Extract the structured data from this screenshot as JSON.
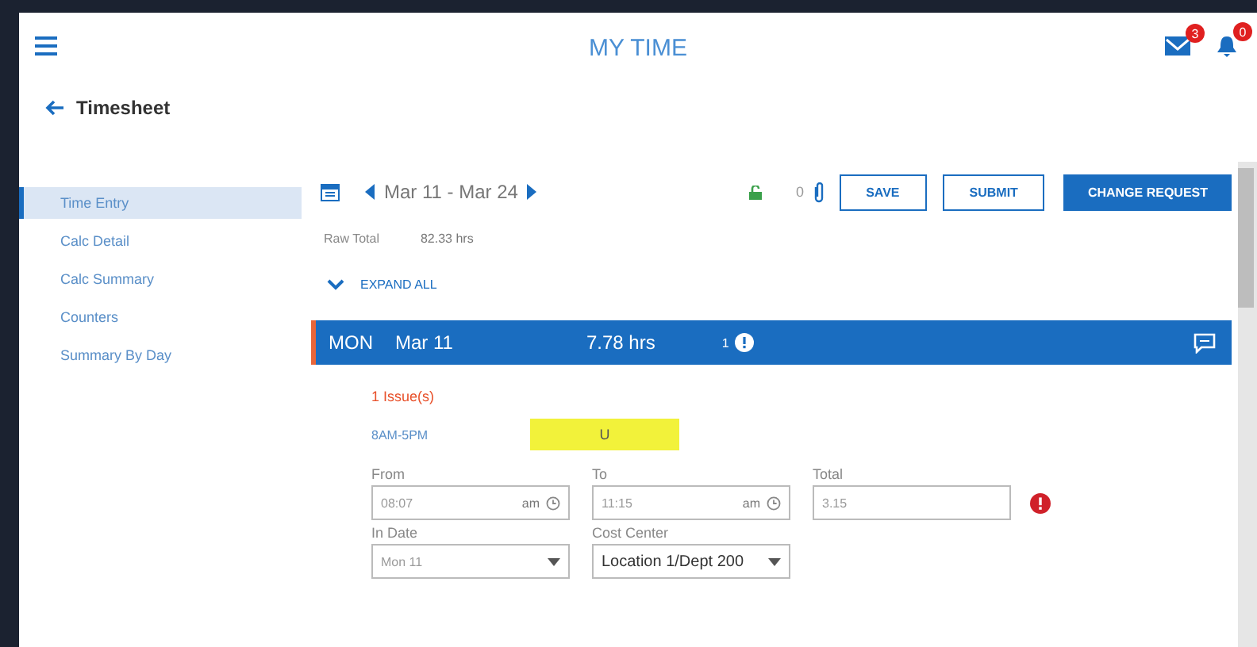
{
  "header": {
    "title": "MY TIME",
    "mail_badge": "3",
    "bell_badge": "0"
  },
  "page": {
    "back_title": "Timesheet"
  },
  "sidebar": {
    "items": [
      {
        "label": "Time Entry",
        "selected": true
      },
      {
        "label": "Calc Detail",
        "selected": false
      },
      {
        "label": "Calc Summary",
        "selected": false
      },
      {
        "label": "Counters",
        "selected": false
      },
      {
        "label": "Summary By Day",
        "selected": false
      }
    ]
  },
  "toolbar": {
    "period": "Mar 11 - Mar 24",
    "attachments": "0",
    "buttons": [
      {
        "label": "SAVE",
        "kind": "outline"
      },
      {
        "label": "SUBMIT",
        "kind": "outline"
      },
      {
        "label": "CHANGE REQUEST",
        "kind": "primary"
      }
    ]
  },
  "raw_total": {
    "label": "Raw Total",
    "value": "82.33 hrs"
  },
  "expand_all": "EXPAND ALL",
  "day": {
    "weekday": "MON",
    "date": "Mar 11",
    "hours": "7.78 hrs",
    "issues": "1",
    "issue_text": "1 Issue(s)",
    "schedule": "8AM-5PM",
    "schedule_value": "U",
    "fields": [
      {
        "label": "From",
        "value": "08:07",
        "suffix": "am",
        "kind": "time"
      },
      {
        "label": "To",
        "value": "11:15",
        "suffix": "am",
        "kind": "time"
      },
      {
        "label": "Total",
        "value": "3.15",
        "kind": "text",
        "error": true
      },
      {
        "label": "In Date",
        "value": "Mon 11",
        "kind": "select"
      },
      {
        "label": "Cost Center",
        "value": "Location 1/Dept 200",
        "kind": "select"
      }
    ]
  }
}
